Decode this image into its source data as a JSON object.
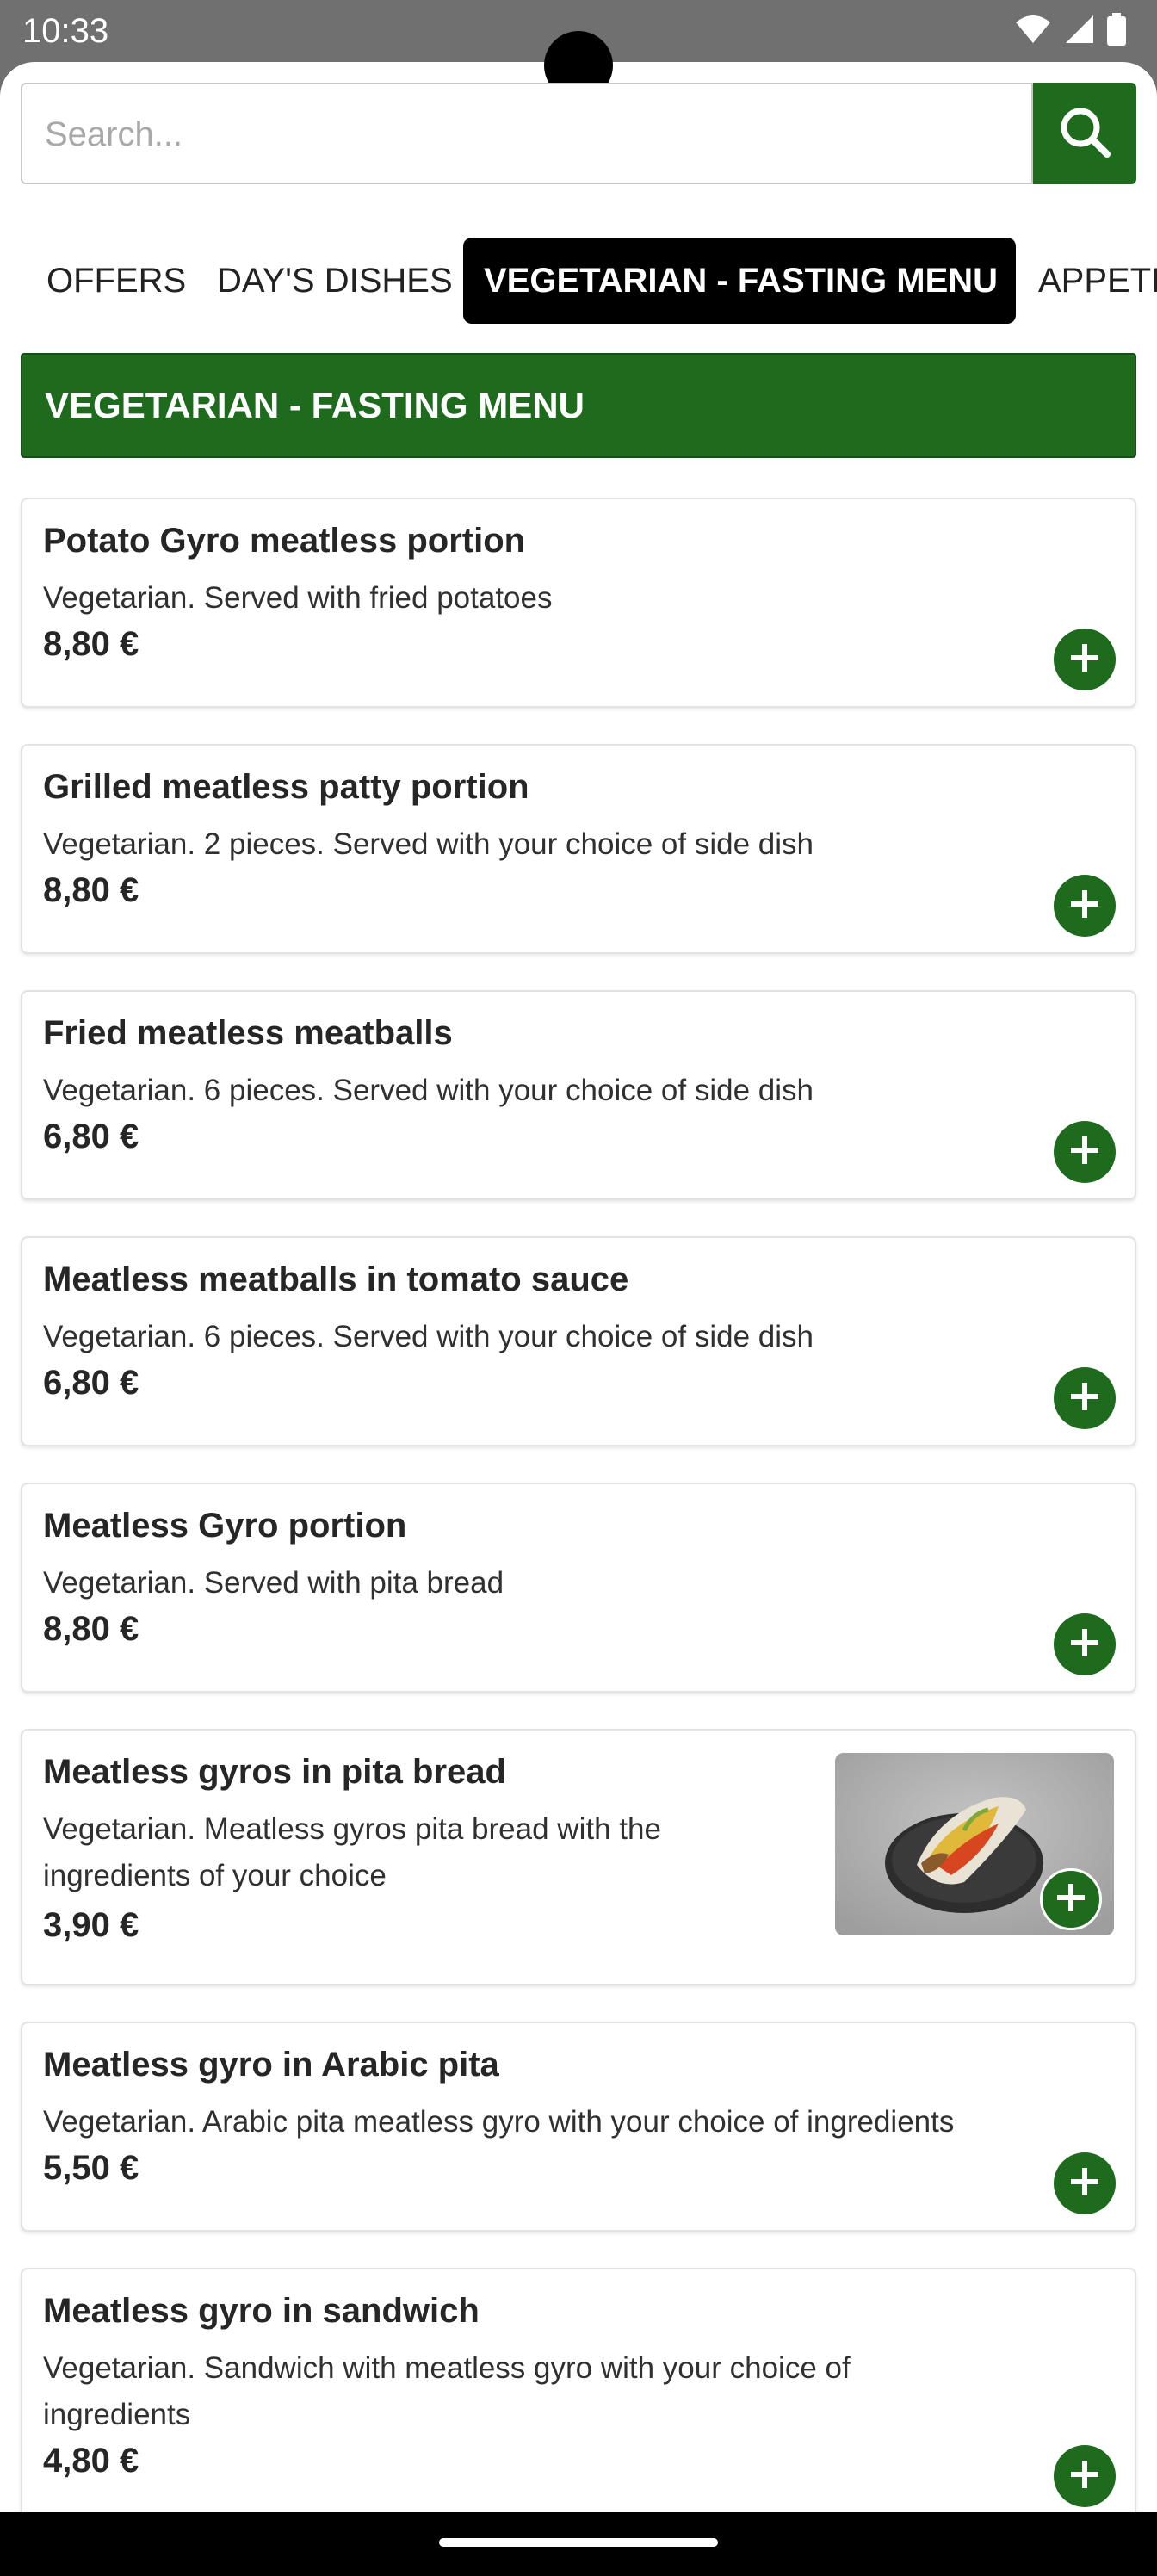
{
  "status_bar": {
    "time": "10:33"
  },
  "search": {
    "placeholder": "Search..."
  },
  "tabs": [
    {
      "label": "OFFERS"
    },
    {
      "label": "DAY'S DISHES"
    },
    {
      "label": "VEGETARIAN - FASTING MENU",
      "active": true
    },
    {
      "label": "APPETIZERS"
    }
  ],
  "section": {
    "title": "VEGETARIAN - FASTING MENU"
  },
  "items": [
    {
      "name": "Potato Gyro meatless portion",
      "description": "Vegetarian. Served with fried potatoes",
      "price": "8,80 €"
    },
    {
      "name": "Grilled meatless patty portion",
      "description": "Vegetarian. 2 pieces. Served with your choice of side dish",
      "price": "8,80 €"
    },
    {
      "name": "Fried meatless meatballs",
      "description": "Vegetarian. 6 pieces. Served with your choice of side dish",
      "price": "6,80 €"
    },
    {
      "name": "Meatless meatballs in tomato sauce",
      "description": "Vegetarian. 6 pieces. Served with your choice of side dish",
      "price": "6,80 €"
    },
    {
      "name": "Meatless Gyro portion",
      "description": "Vegetarian. Served with pita bread",
      "price": "8,80 €"
    },
    {
      "name": "Meatless gyros in pita bread",
      "description": "Vegetarian. Meatless gyros pita bread with the ingredients of your choice",
      "price": "3,90 €",
      "has_image": true
    },
    {
      "name": "Meatless gyro in Arabic pita",
      "description": "Vegetarian. Arabic pita meatless gyro with your choice of ingredients",
      "price": "5,50 €"
    },
    {
      "name": "Meatless gyro in sandwich",
      "description": "Vegetarian. Sandwich with meatless gyro with your choice of ingredients",
      "price": "4,80 €"
    }
  ],
  "colors": {
    "brand_green": "#1e6b1e",
    "active_tab_bg": "#000000",
    "status_bar_bg": "#707070"
  },
  "icons": {
    "search": "search-icon",
    "add": "plus-icon",
    "wifi": "wifi-icon",
    "signal": "signal-icon",
    "battery": "battery-icon"
  }
}
